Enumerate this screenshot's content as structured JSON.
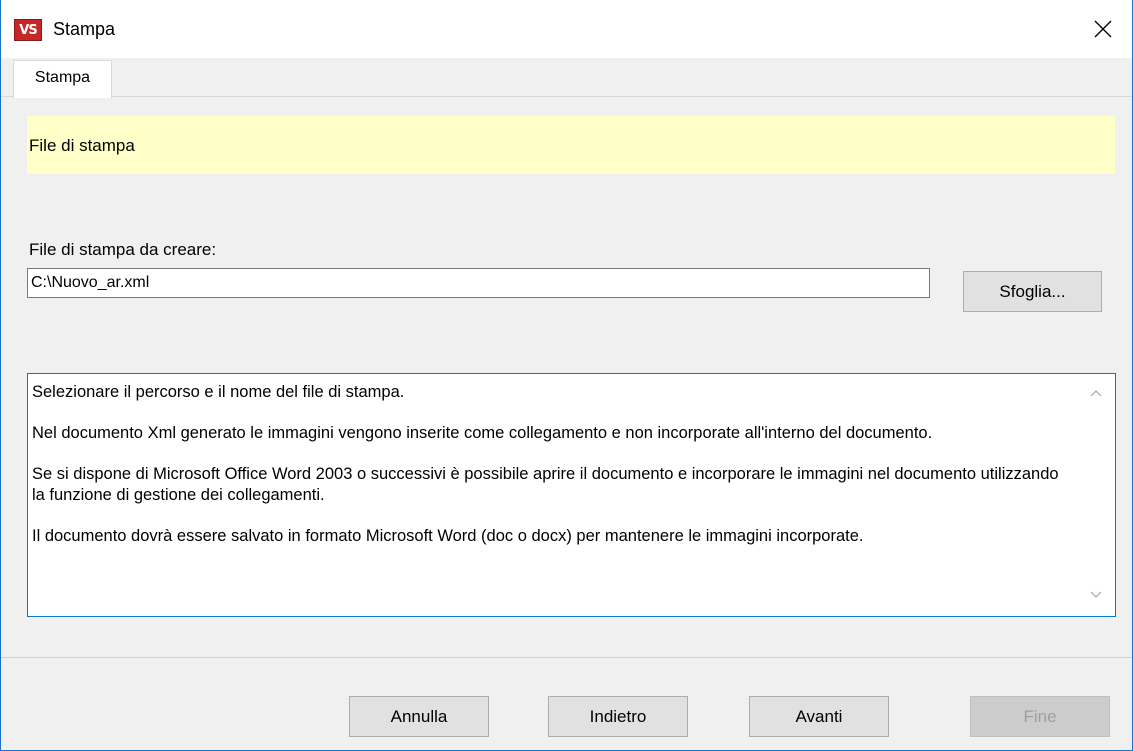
{
  "window": {
    "title": "Stampa",
    "app_icon_text": "VS",
    "close_symbol": "✕"
  },
  "tabs": [
    {
      "label": "Stampa",
      "active": true
    }
  ],
  "banner": {
    "text": "File di stampa",
    "color": "#ffffc8"
  },
  "file": {
    "label": "File di stampa da creare:",
    "value": "C:\\Nuovo_ar.xml",
    "browse_label": "Sfoglia..."
  },
  "info": {
    "paragraphs": [
      "Selezionare il percorso e il nome del file di stampa.",
      "Nel documento Xml generato le immagini vengono inserite come collegamento e non incorporate all'interno del documento.",
      "Se si dispone di Microsoft Office Word 2003 o successivi è possibile aprire il documento e incorporare le immagini nel documento utilizzando la funzione di gestione dei collegamenti.",
      "Il documento dovrà essere salvato in formato Microsoft Word (doc o docx) per mantenere le immagini incorporate."
    ]
  },
  "buttons": {
    "cancel": "Annulla",
    "back": "Indietro",
    "next": "Avanti",
    "finish": "Fine"
  },
  "icons": {
    "close": "close-icon",
    "scroll_up": "chevron-up-icon",
    "scroll_down": "chevron-down-icon"
  }
}
